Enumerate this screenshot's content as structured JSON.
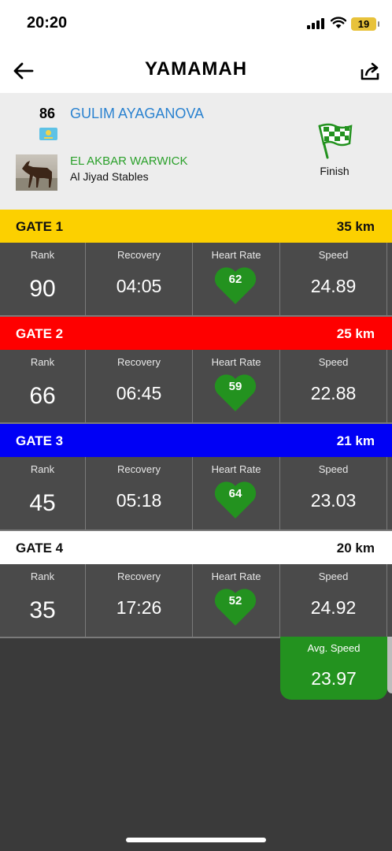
{
  "status_bar": {
    "time": "20:20",
    "battery": "19"
  },
  "nav": {
    "title": "YAMAMAH",
    "back_icon": "back-arrow-icon",
    "share_icon": "share-icon"
  },
  "rider": {
    "bib": "86",
    "name": "GULIM AYAGANOVA",
    "flag_icon": "kazakhstan-flag-icon",
    "horse": "EL AKBAR WARWICK",
    "stable": "Al Jiyad Stables",
    "status_label": "Finish",
    "status_icon": "checkered-flag-icon"
  },
  "labels": {
    "rank": "Rank",
    "recovery": "Recovery",
    "heart_rate": "Heart Rate",
    "speed": "Speed"
  },
  "colors": {
    "heart": "#23921f",
    "gate1": "#fcd000",
    "gate2": "#fe0000",
    "gate3": "#0000f5",
    "gate4": "#ffffff",
    "rider_name": "#2a82d0",
    "horse_name": "#2aa02a"
  },
  "gates": [
    {
      "name": "GATE 1",
      "distance": "35 km",
      "rank": "90",
      "recovery": "04:05",
      "heart_rate": "62",
      "speed": "24.89"
    },
    {
      "name": "GATE 2",
      "distance": "25 km",
      "rank": "66",
      "recovery": "06:45",
      "heart_rate": "59",
      "speed": "22.88"
    },
    {
      "name": "GATE 3",
      "distance": "21 km",
      "rank": "45",
      "recovery": "05:18",
      "heart_rate": "64",
      "speed": "23.03"
    },
    {
      "name": "GATE 4",
      "distance": "20 km",
      "rank": "35",
      "recovery": "17:26",
      "heart_rate": "52",
      "speed": "24.92"
    }
  ],
  "avg_speed": {
    "label": "Avg. Speed",
    "value": "23.97"
  }
}
